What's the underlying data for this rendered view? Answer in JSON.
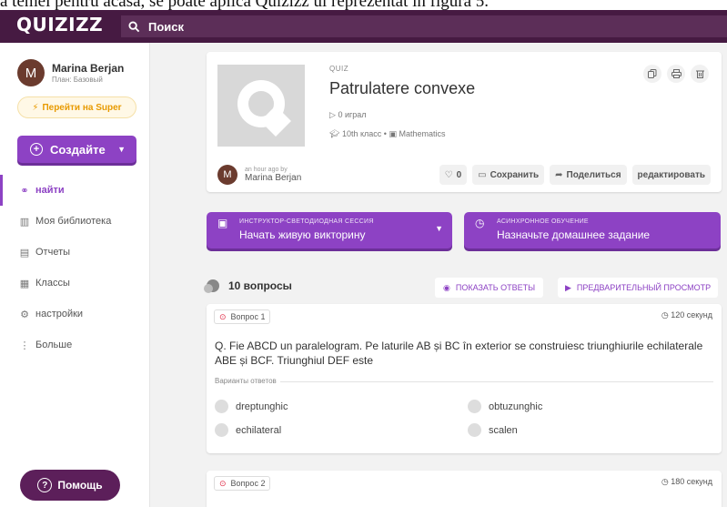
{
  "top_text": "a temei pentru acasa, se poate aplica Quizizz ul reprezentat în figura 5.",
  "header": {
    "logo": "QUIZIZZ",
    "search_placeholder": "Поиск"
  },
  "sidebar": {
    "user_initial": "M",
    "user_name": "Marina Berjan",
    "plan": "План: Базовый",
    "super_label": "Перейти на Super",
    "create_label": "Создайте",
    "items": [
      {
        "label": "найти",
        "icon": "binoculars-icon",
        "active": true
      },
      {
        "label": "Моя библиотека",
        "icon": "library-icon",
        "active": false
      },
      {
        "label": "Отчеты",
        "icon": "reports-icon",
        "active": false
      },
      {
        "label": "Классы",
        "icon": "classes-icon",
        "active": false
      },
      {
        "label": "настройки",
        "icon": "settings-icon",
        "active": false
      },
      {
        "label": "Больше",
        "icon": "more-icon",
        "active": false
      }
    ],
    "help_label": "Помощь"
  },
  "quiz": {
    "type_label": "QUIZ",
    "title": "Patrulatere convexe",
    "played": "0 играл",
    "grade": "10th класс",
    "subject": "Mathematics",
    "author_time": "an hour ago by",
    "author_name": "Marina Berjan",
    "author_initial": "M",
    "likes": "0",
    "save_label": "Сохранить",
    "share_label": "Поделиться",
    "edit_label": "редактировать"
  },
  "session": {
    "live_sub": "ИНСТРУКТОР-СВЕТОДИОДНАЯ СЕССИЯ",
    "live_main": "Начать живую викторину",
    "hw_sub": "АСИНХРОННОЕ ОБУЧЕНИЕ",
    "hw_main": "Назначьте домашнее задание"
  },
  "questions_header": {
    "count": "10 вопросы",
    "show_answers": "ПОКАЗАТЬ ОТВЕТЫ",
    "preview": "ПРЕДВАРИТЕЛЬНЫЙ ПРОСМОТР"
  },
  "questions": [
    {
      "badge": "Вопрос 1",
      "time": "120 секунд",
      "text": "Q. Fie ABCD un paralelogram. Pe laturile AB și BC în exterior se construiesc triunghiurile echilaterale ABE și BCF. Triunghiul DEF este",
      "options_label": "Варианты ответов",
      "options": [
        "dreptunghic",
        "obtuzunghic",
        "echilateral",
        "scalen"
      ]
    },
    {
      "badge": "Вопрос 2",
      "time": "180 секунд"
    }
  ],
  "colors": {
    "header_bg": "#461a42",
    "accent": "#8d42c4",
    "help_bg": "#5c1f5a"
  }
}
